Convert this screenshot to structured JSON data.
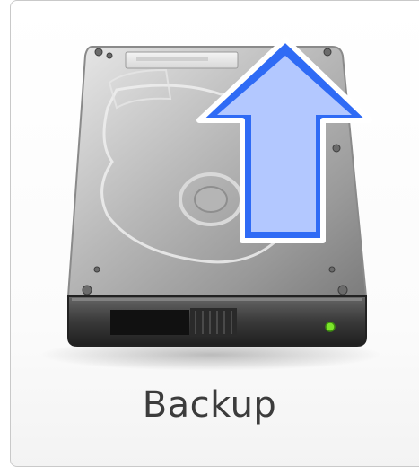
{
  "tile": {
    "label": "Backup",
    "icon": "hard-drive-backup-icon"
  },
  "colors": {
    "arrow_fill": "#b3c8ff",
    "arrow_stroke": "#2f6bf5",
    "led": "#7ce52a",
    "label_text": "#3c3c3c"
  }
}
